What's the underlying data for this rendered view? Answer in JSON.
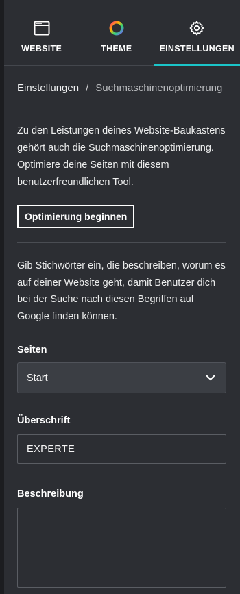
{
  "tabs": [
    {
      "label": "WEBSITE",
      "icon": "browser-window-icon",
      "active": false
    },
    {
      "label": "THEME",
      "icon": "color-wheel-icon",
      "active": true
    },
    {
      "label": "EINSTELLUNGEN",
      "icon": "gear-icon",
      "active": true
    }
  ],
  "breadcrumb": {
    "parent": "Einstellungen",
    "separator": "/",
    "current": "Suchmaschinenoptimierung"
  },
  "intro_text": "Zu den Leistungen deines Website-Baukastens gehört auch die Suchmaschinenoptimierung. Optimiere deine Seiten mit diesem benutzerfreundlichen Tool.",
  "start_button_label": "Optimierung beginnen",
  "keywords_info": "Gib Stichwörter ein, die beschreiben, worum es auf deiner Website geht, damit Benutzer dich bei der Suche nach diesen Begriffen auf Google finden können.",
  "pages_field": {
    "label": "Seiten",
    "selected": "Start"
  },
  "heading_field": {
    "label": "Überschrift",
    "value": "EXPERTE"
  },
  "description_field": {
    "label": "Beschreibung",
    "value": ""
  },
  "colors": {
    "accent": "#1bc5c9",
    "background": "#2c2e33",
    "select_bg": "#3b3e44"
  }
}
